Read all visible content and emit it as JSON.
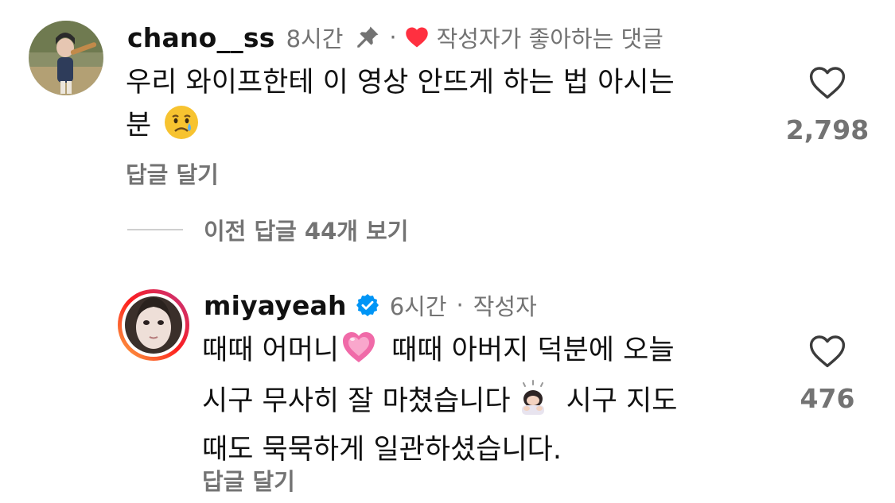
{
  "comments": [
    {
      "username": "chano__ss",
      "time": "8시간",
      "liked_by_author_label": "작성자가 좋아하는 댓글",
      "line1": "우리 와이프한테 이 영상 안뜨게 하는 법 아시는",
      "line2": "분",
      "emoji_1": "crying-face",
      "reply_label": "답글 달기",
      "like_count": "2,798",
      "pinned": true
    },
    {
      "username": "miyayeah",
      "verified": true,
      "time": "6시간",
      "separator": "·",
      "author_label": "작성자",
      "line1a": "때때 어머니",
      "line1b": "때때 아버지 덕분에 오늘",
      "line2a": "시구 무사히 잘 마쳤습니다",
      "line2b": "시구 지도",
      "line3": "때도 묵묵하게 일관하셨습니다.",
      "emoji_heart": "growing-heart",
      "emoji_bow": "person-bowing",
      "reply_label": "답글 달기",
      "like_count": "476"
    }
  ],
  "view_replies_label": "이전 답글 44개 보기",
  "colors": {
    "text": "#111111",
    "secondary": "#737373",
    "heart_red": "#ff3040",
    "verified_blue": "#0095f6"
  }
}
